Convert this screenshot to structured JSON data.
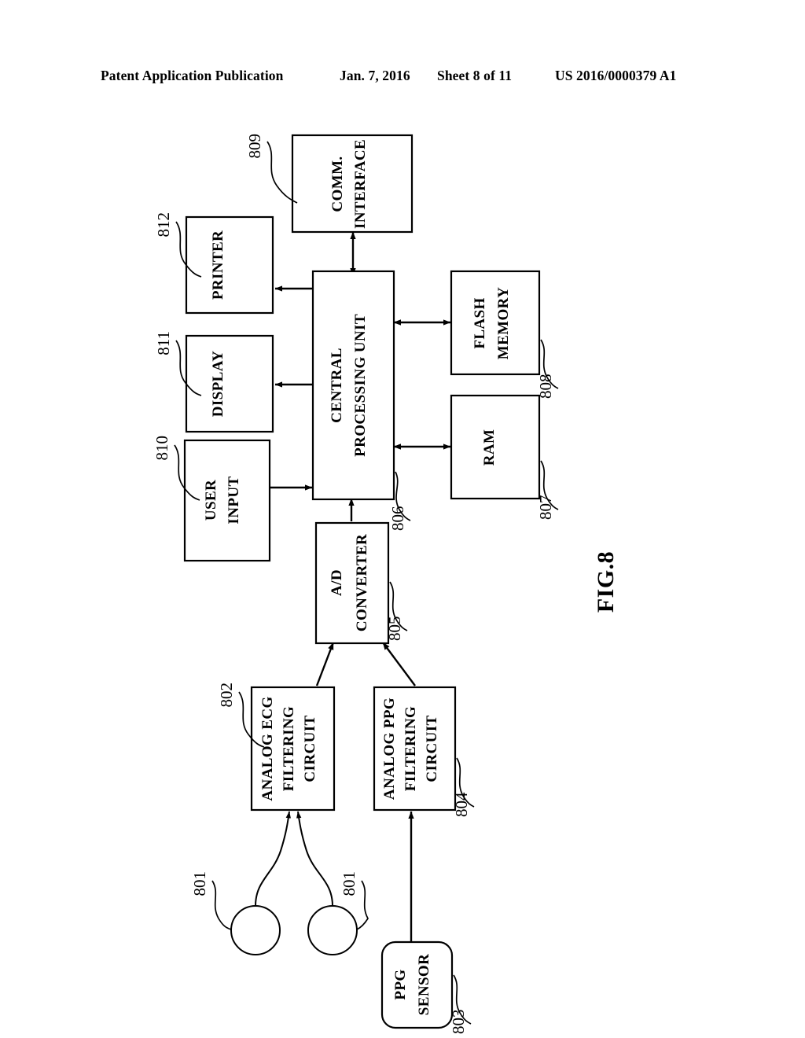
{
  "header": {
    "publication": "Patent Application Publication",
    "date": "Jan. 7, 2016",
    "sheet": "Sheet 8 of 11",
    "patent_number": "US 2016/0000379 A1"
  },
  "figure": {
    "label": "FIG.8",
    "caption_rotation_deg": -90
  },
  "blocks": [
    {
      "id": "comm_interface",
      "label": "COMM. INTERFACE",
      "ref": "809",
      "shape": "rect"
    },
    {
      "id": "printer",
      "label": "PRINTER",
      "ref": "812",
      "shape": "rect"
    },
    {
      "id": "display",
      "label": "DISPLAY",
      "ref": "811",
      "shape": "rect"
    },
    {
      "id": "user_input",
      "label": "USER INPUT",
      "ref": "810",
      "shape": "rect"
    },
    {
      "id": "cpu",
      "label": "CENTRAL PROCESSING UNIT",
      "ref": "806",
      "shape": "rect"
    },
    {
      "id": "flash_memory",
      "label": "FLASH MEMORY",
      "ref": "808",
      "shape": "rect"
    },
    {
      "id": "ram",
      "label": "RAM",
      "ref": "807",
      "shape": "rect"
    },
    {
      "id": "ad_converter",
      "label": "A/D CONVERTER",
      "ref": "805",
      "shape": "rect"
    },
    {
      "id": "ecg_filter",
      "label": "ANALOG ECG FILTERING CIRCUIT",
      "ref": "802",
      "shape": "rect"
    },
    {
      "id": "ppg_filter",
      "label": "ANALOG PPG FILTERING CIRCUIT",
      "ref": "804",
      "shape": "rect"
    },
    {
      "id": "ppg_sensor",
      "label": "PPG SENSOR",
      "ref": "803",
      "shape": "rounded-rect"
    },
    {
      "id": "electrode_left",
      "label": "",
      "ref": "801",
      "shape": "circle"
    },
    {
      "id": "electrode_right",
      "label": "",
      "ref": "801",
      "shape": "circle"
    }
  ],
  "block_text": {
    "comm_interface_line1": "COMM.",
    "comm_interface_line2": "INTERFACE",
    "printer": "PRINTER",
    "display": "DISPLAY",
    "user_input_line1": "USER",
    "user_input_line2": "INPUT",
    "cpu_line1": "CENTRAL",
    "cpu_line2": "PROCESSING UNIT",
    "flash_line1": "FLASH",
    "flash_line2": "MEMORY",
    "ram": "RAM",
    "ad_line1": "A/D",
    "ad_line2": "CONVERTER",
    "ecg_line1": "ANALOG ECG",
    "ecg_line2": "FILTERING",
    "ecg_line3": "CIRCUIT",
    "ppg_line1": "ANALOG PPG",
    "ppg_line2": "FILTERING",
    "ppg_line3": "CIRCUIT",
    "ppg_sensor_line1": "PPG",
    "ppg_sensor_line2": "SENSOR"
  },
  "ref_numbers": {
    "r801_left": "801",
    "r801_right": "801",
    "r802": "802",
    "r803": "803",
    "r804": "804",
    "r805": "805",
    "r806": "806",
    "r807": "807",
    "r808": "808",
    "r809": "809",
    "r810": "810",
    "r811": "811",
    "r812": "812"
  },
  "connections": [
    {
      "from": "cpu",
      "to": "comm_interface",
      "arrow": "both"
    },
    {
      "from": "cpu",
      "to": "printer",
      "arrow": "to"
    },
    {
      "from": "cpu",
      "to": "display",
      "arrow": "to"
    },
    {
      "from": "user_input",
      "to": "cpu",
      "arrow": "to"
    },
    {
      "from": "cpu",
      "to": "flash_memory",
      "arrow": "both"
    },
    {
      "from": "cpu",
      "to": "ram",
      "arrow": "both"
    },
    {
      "from": "ad_converter",
      "to": "cpu",
      "arrow": "to"
    },
    {
      "from": "ecg_filter",
      "to": "ad_converter",
      "arrow": "to"
    },
    {
      "from": "ppg_filter",
      "to": "ad_converter",
      "arrow": "to"
    },
    {
      "from": "electrode_left",
      "to": "ecg_filter",
      "arrow": "to"
    },
    {
      "from": "electrode_right",
      "to": "ecg_filter",
      "arrow": "to"
    },
    {
      "from": "ppg_sensor",
      "to": "ppg_filter",
      "arrow": "to"
    }
  ],
  "colors": {
    "ink": "#000000",
    "paper": "#ffffff"
  }
}
